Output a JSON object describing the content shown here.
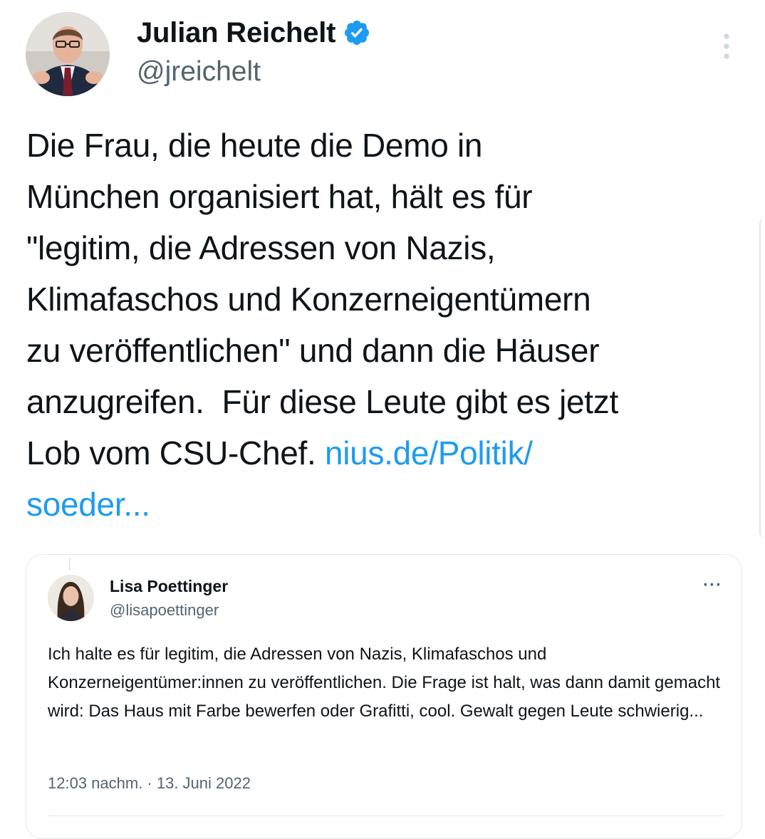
{
  "tweet": {
    "author_name": "Julian Reichelt",
    "author_handle": "@jreichelt",
    "text_main": "Die Frau, die heute die Demo in\nMünchen organisiert hat, hält es für\n\"legitim, die Adressen von Nazis,\nKlimafaschos und Konzerneigentümern\nzu veröffentlichen\" und dann die Häuser\nanzugreifen.  Für diese Leute gibt es jetzt\nLob vom CSU-Chef. ",
    "link_text": "nius.de/Politik/\nsoeder...",
    "verified_color": "#1d9bf0",
    "link_color": "#1d9bf0"
  },
  "quoted_tweet": {
    "author_name": "Lisa Poettinger",
    "author_handle": "@lisapoettinger",
    "more_label": "···",
    "text": "Ich halte es für legitim, die Adressen von Nazis, Klimafaschos und Konzerneigentümer:innen zu veröffentlichen. Die Frage ist halt, was dann damit gemacht wird: Das Haus mit Farbe bewerfen oder Grafitti, cool. Gewalt gegen Leute schwierig...",
    "timestamp": "12:03 nachm. · 13. Juni 2022"
  },
  "icons": {
    "verified": "verified-badge-icon",
    "more_vertical": "more-vertical-icon",
    "more_horizontal": "more-horizontal-icon"
  }
}
